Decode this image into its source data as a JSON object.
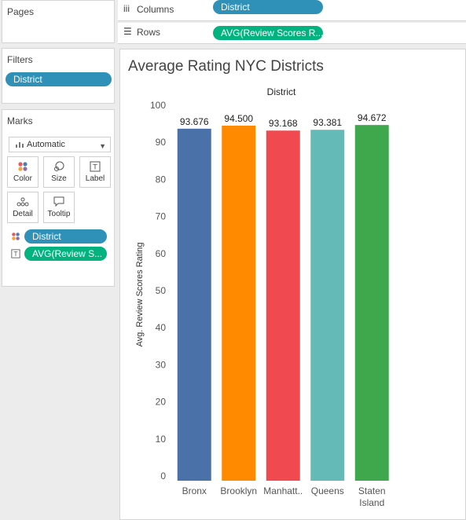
{
  "left_panel": {
    "pages": {
      "title": "Pages"
    },
    "filters": {
      "title": "Filters",
      "pills": [
        "District"
      ]
    },
    "marks": {
      "title": "Marks",
      "mark_type": "Automatic",
      "buttons": [
        {
          "label": "Color",
          "icon": "color-dots-icon"
        },
        {
          "label": "Size",
          "icon": "size-icon"
        },
        {
          "label": "Label",
          "icon": "label-icon"
        },
        {
          "label": "Detail",
          "icon": "detail-icon"
        },
        {
          "label": "Tooltip",
          "icon": "tooltip-icon"
        }
      ],
      "fields": [
        {
          "label": "District",
          "icon": "color-dots-icon",
          "color": "#2f90b8"
        },
        {
          "label": "AVG(Review S...",
          "icon": "label-icon",
          "color": "#02b37f"
        }
      ]
    }
  },
  "shelves": {
    "columns": {
      "label": "Columns",
      "pill": "District",
      "pill_color": "#2f90b8"
    },
    "rows": {
      "label": "Rows",
      "pill": "AVG(Review Scores R...",
      "pill_color": "#02b37f"
    }
  },
  "chart_data": {
    "type": "bar",
    "title": "Average Rating NYC Districts",
    "header": "District",
    "ylabel": "Avg. Review Scores Rating",
    "xlabel": "",
    "ylim": [
      0,
      100
    ],
    "yticks": [
      0,
      10,
      20,
      30,
      40,
      50,
      60,
      70,
      80,
      90,
      100
    ],
    "categories": [
      "Bronx",
      "Brooklyn",
      "Manhatt..",
      "Queens",
      "Staten Island"
    ],
    "category_lines": [
      [
        "Bronx"
      ],
      [
        "Brooklyn"
      ],
      [
        "Manhatt.."
      ],
      [
        "Queens"
      ],
      [
        "Staten",
        "Island"
      ]
    ],
    "values": [
      93.676,
      94.5,
      93.168,
      93.381,
      94.672
    ],
    "value_labels": [
      "93.676",
      "94.500",
      "93.168",
      "93.381",
      "94.672"
    ],
    "colors": [
      "#4a72a8",
      "#ff8a00",
      "#f04a50",
      "#63bab6",
      "#40a84c"
    ],
    "grid": false,
    "legend": "none"
  }
}
